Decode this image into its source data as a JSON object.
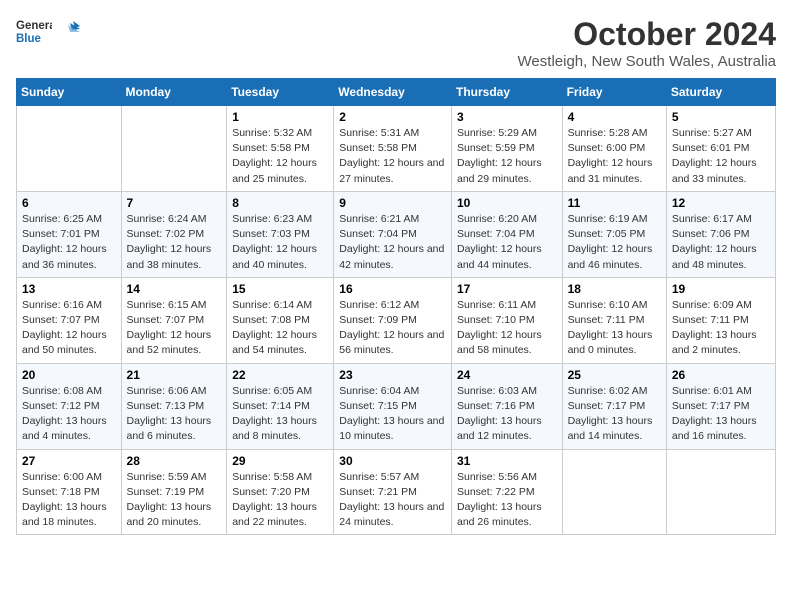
{
  "logo": {
    "line1": "General",
    "line2": "Blue"
  },
  "title": "October 2024",
  "location": "Westleigh, New South Wales, Australia",
  "days_header": [
    "Sunday",
    "Monday",
    "Tuesday",
    "Wednesday",
    "Thursday",
    "Friday",
    "Saturday"
  ],
  "weeks": [
    [
      {
        "day": "",
        "info": ""
      },
      {
        "day": "",
        "info": ""
      },
      {
        "day": "1",
        "sunrise": "5:32 AM",
        "sunset": "5:58 PM",
        "daylight": "12 hours and 25 minutes."
      },
      {
        "day": "2",
        "sunrise": "5:31 AM",
        "sunset": "5:58 PM",
        "daylight": "12 hours and 27 minutes."
      },
      {
        "day": "3",
        "sunrise": "5:29 AM",
        "sunset": "5:59 PM",
        "daylight": "12 hours and 29 minutes."
      },
      {
        "day": "4",
        "sunrise": "5:28 AM",
        "sunset": "6:00 PM",
        "daylight": "12 hours and 31 minutes."
      },
      {
        "day": "5",
        "sunrise": "5:27 AM",
        "sunset": "6:01 PM",
        "daylight": "12 hours and 33 minutes."
      }
    ],
    [
      {
        "day": "6",
        "sunrise": "6:25 AM",
        "sunset": "7:01 PM",
        "daylight": "12 hours and 36 minutes."
      },
      {
        "day": "7",
        "sunrise": "6:24 AM",
        "sunset": "7:02 PM",
        "daylight": "12 hours and 38 minutes."
      },
      {
        "day": "8",
        "sunrise": "6:23 AM",
        "sunset": "7:03 PM",
        "daylight": "12 hours and 40 minutes."
      },
      {
        "day": "9",
        "sunrise": "6:21 AM",
        "sunset": "7:04 PM",
        "daylight": "12 hours and 42 minutes."
      },
      {
        "day": "10",
        "sunrise": "6:20 AM",
        "sunset": "7:04 PM",
        "daylight": "12 hours and 44 minutes."
      },
      {
        "day": "11",
        "sunrise": "6:19 AM",
        "sunset": "7:05 PM",
        "daylight": "12 hours and 46 minutes."
      },
      {
        "day": "12",
        "sunrise": "6:17 AM",
        "sunset": "7:06 PM",
        "daylight": "12 hours and 48 minutes."
      }
    ],
    [
      {
        "day": "13",
        "sunrise": "6:16 AM",
        "sunset": "7:07 PM",
        "daylight": "12 hours and 50 minutes."
      },
      {
        "day": "14",
        "sunrise": "6:15 AM",
        "sunset": "7:07 PM",
        "daylight": "12 hours and 52 minutes."
      },
      {
        "day": "15",
        "sunrise": "6:14 AM",
        "sunset": "7:08 PM",
        "daylight": "12 hours and 54 minutes."
      },
      {
        "day": "16",
        "sunrise": "6:12 AM",
        "sunset": "7:09 PM",
        "daylight": "12 hours and 56 minutes."
      },
      {
        "day": "17",
        "sunrise": "6:11 AM",
        "sunset": "7:10 PM",
        "daylight": "12 hours and 58 minutes."
      },
      {
        "day": "18",
        "sunrise": "6:10 AM",
        "sunset": "7:11 PM",
        "daylight": "13 hours and 0 minutes."
      },
      {
        "day": "19",
        "sunrise": "6:09 AM",
        "sunset": "7:11 PM",
        "daylight": "13 hours and 2 minutes."
      }
    ],
    [
      {
        "day": "20",
        "sunrise": "6:08 AM",
        "sunset": "7:12 PM",
        "daylight": "13 hours and 4 minutes."
      },
      {
        "day": "21",
        "sunrise": "6:06 AM",
        "sunset": "7:13 PM",
        "daylight": "13 hours and 6 minutes."
      },
      {
        "day": "22",
        "sunrise": "6:05 AM",
        "sunset": "7:14 PM",
        "daylight": "13 hours and 8 minutes."
      },
      {
        "day": "23",
        "sunrise": "6:04 AM",
        "sunset": "7:15 PM",
        "daylight": "13 hours and 10 minutes."
      },
      {
        "day": "24",
        "sunrise": "6:03 AM",
        "sunset": "7:16 PM",
        "daylight": "13 hours and 12 minutes."
      },
      {
        "day": "25",
        "sunrise": "6:02 AM",
        "sunset": "7:17 PM",
        "daylight": "13 hours and 14 minutes."
      },
      {
        "day": "26",
        "sunrise": "6:01 AM",
        "sunset": "7:17 PM",
        "daylight": "13 hours and 16 minutes."
      }
    ],
    [
      {
        "day": "27",
        "sunrise": "6:00 AM",
        "sunset": "7:18 PM",
        "daylight": "13 hours and 18 minutes."
      },
      {
        "day": "28",
        "sunrise": "5:59 AM",
        "sunset": "7:19 PM",
        "daylight": "13 hours and 20 minutes."
      },
      {
        "day": "29",
        "sunrise": "5:58 AM",
        "sunset": "7:20 PM",
        "daylight": "13 hours and 22 minutes."
      },
      {
        "day": "30",
        "sunrise": "5:57 AM",
        "sunset": "7:21 PM",
        "daylight": "13 hours and 24 minutes."
      },
      {
        "day": "31",
        "sunrise": "5:56 AM",
        "sunset": "7:22 PM",
        "daylight": "13 hours and 26 minutes."
      },
      {
        "day": "",
        "info": ""
      },
      {
        "day": "",
        "info": ""
      }
    ]
  ]
}
